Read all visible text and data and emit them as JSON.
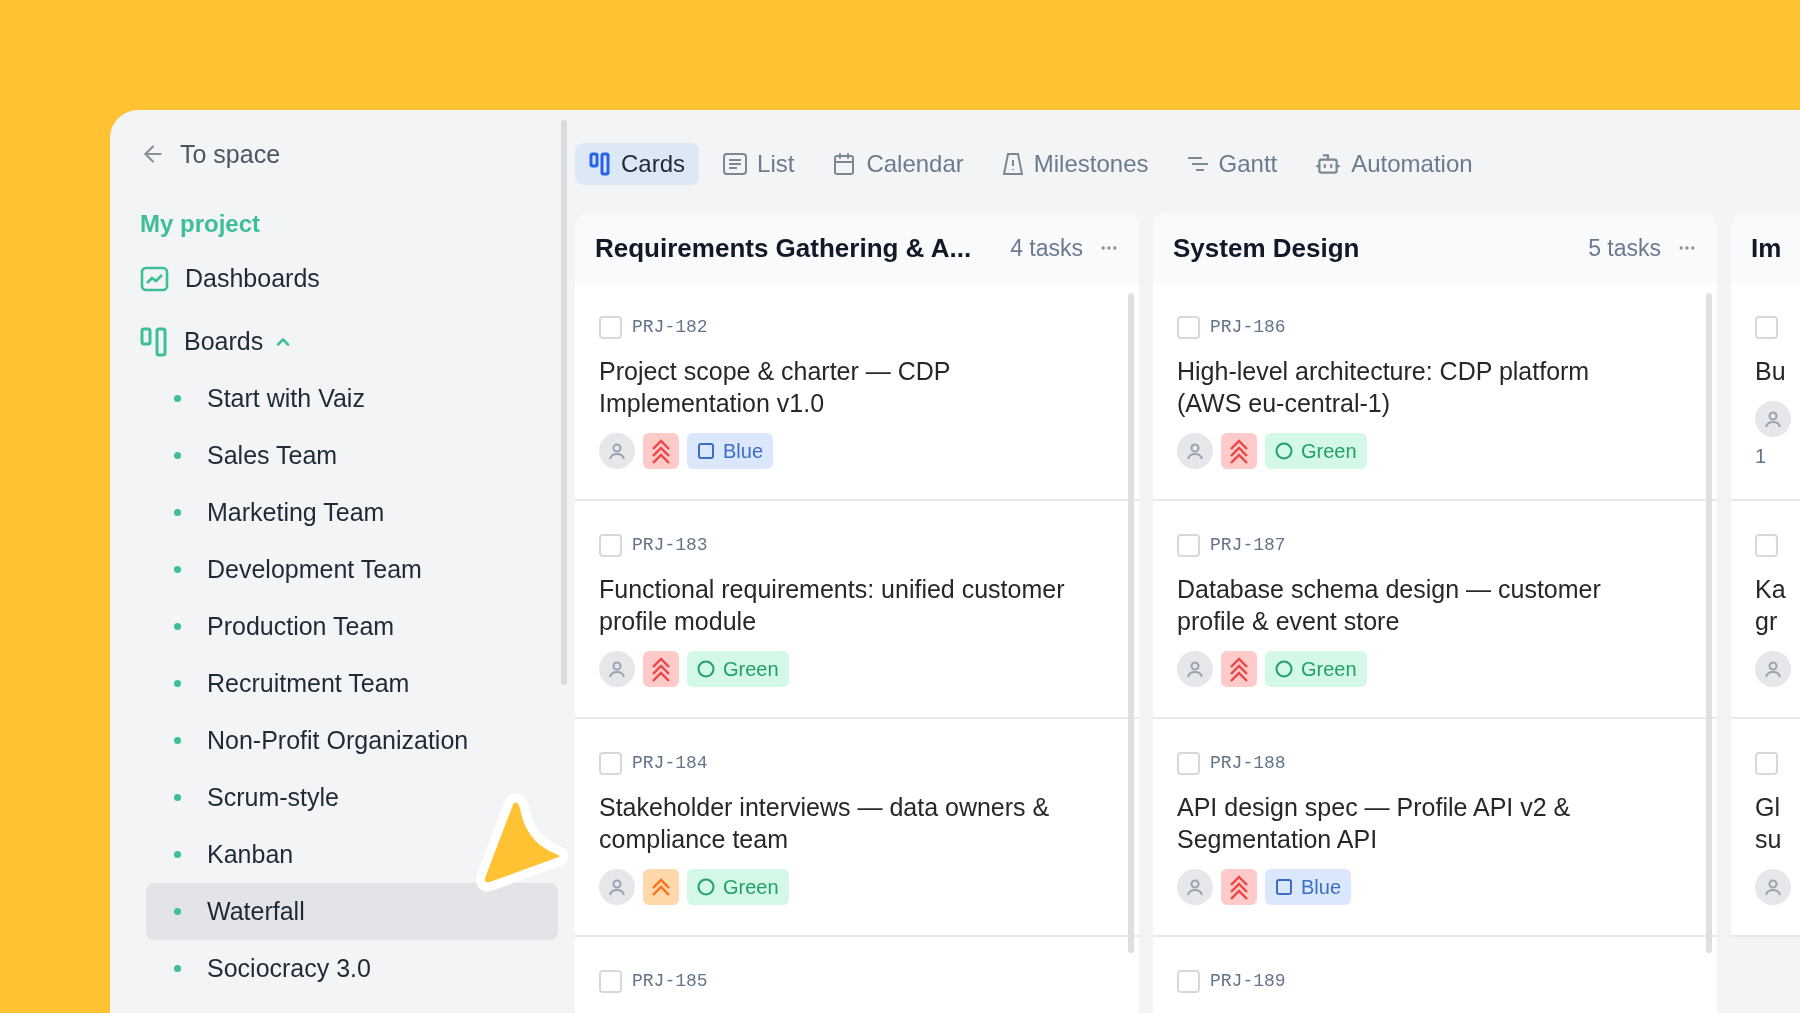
{
  "sidebar": {
    "back": "To space",
    "project": "My project",
    "items": [
      {
        "label": "Dashboards",
        "kind": "dashboards"
      },
      {
        "label": "Boards",
        "kind": "boards",
        "expanded": true,
        "children": [
          {
            "label": "Start with Vaiz",
            "selected": false
          },
          {
            "label": "Sales Team",
            "selected": false
          },
          {
            "label": "Marketing Team",
            "selected": false
          },
          {
            "label": "Development Team",
            "selected": false
          },
          {
            "label": "Production Team",
            "selected": false
          },
          {
            "label": "Recruitment Team",
            "selected": false
          },
          {
            "label": "Non-Profit Organization",
            "selected": false
          },
          {
            "label": "Scrum-style",
            "selected": false
          },
          {
            "label": "Kanban",
            "selected": false
          },
          {
            "label": "Waterfall",
            "selected": true
          },
          {
            "label": "Sociocracy 3.0",
            "selected": false
          }
        ]
      }
    ]
  },
  "tabs": [
    {
      "label": "Cards",
      "selected": true
    },
    {
      "label": "List",
      "selected": false
    },
    {
      "label": "Calendar",
      "selected": false
    },
    {
      "label": "Milestones",
      "selected": false
    },
    {
      "label": "Gantt",
      "selected": false
    },
    {
      "label": "Automation",
      "selected": false
    }
  ],
  "columns": [
    {
      "title": "Requirements Gathering & A...",
      "count": "4 tasks",
      "cards": [
        {
          "id": "PRJ-182",
          "title": "Project scope & charter — CDP Implementation v1.0",
          "priority": {
            "kind": "high"
          },
          "tag": {
            "label": "Blue",
            "kind": "blue"
          },
          "checked": false
        },
        {
          "id": "PRJ-183",
          "title": "Functional requirements: unified customer profile module",
          "priority": {
            "kind": "high"
          },
          "tag": {
            "label": "Green",
            "kind": "green"
          },
          "checked": false
        },
        {
          "id": "PRJ-184",
          "title": "Stakeholder interviews — data owners & compliance team",
          "priority": {
            "kind": "medium"
          },
          "tag": {
            "label": "Green",
            "kind": "green"
          },
          "checked": false
        },
        {
          "id": "PRJ-185",
          "checked": false
        }
      ]
    },
    {
      "title": "System Design",
      "count": "5 tasks",
      "cards": [
        {
          "id": "PRJ-186",
          "title": "High-level architecture: CDP platform (AWS eu-central-1)",
          "priority": {
            "kind": "high"
          },
          "tag": {
            "label": "Green",
            "kind": "green"
          },
          "checked": false
        },
        {
          "id": "PRJ-187",
          "title": "Database schema design — customer profile & event store",
          "priority": {
            "kind": "high"
          },
          "tag": {
            "label": "Green",
            "kind": "green"
          },
          "checked": false
        },
        {
          "id": "PRJ-188",
          "title": "API design spec — Profile API v2 & Segmentation API",
          "priority": {
            "kind": "high"
          },
          "tag": {
            "label": "Blue",
            "kind": "blue"
          },
          "checked": false
        },
        {
          "id": "PRJ-189",
          "checked": false
        }
      ]
    },
    {
      "title": "Im",
      "cards": [
        {
          "title": "Bu",
          "subcount": "1",
          "checked": false
        },
        {
          "title": "Ka\ngr",
          "checked": false
        },
        {
          "title": "Gl\nsu",
          "checked": false
        }
      ]
    }
  ]
}
